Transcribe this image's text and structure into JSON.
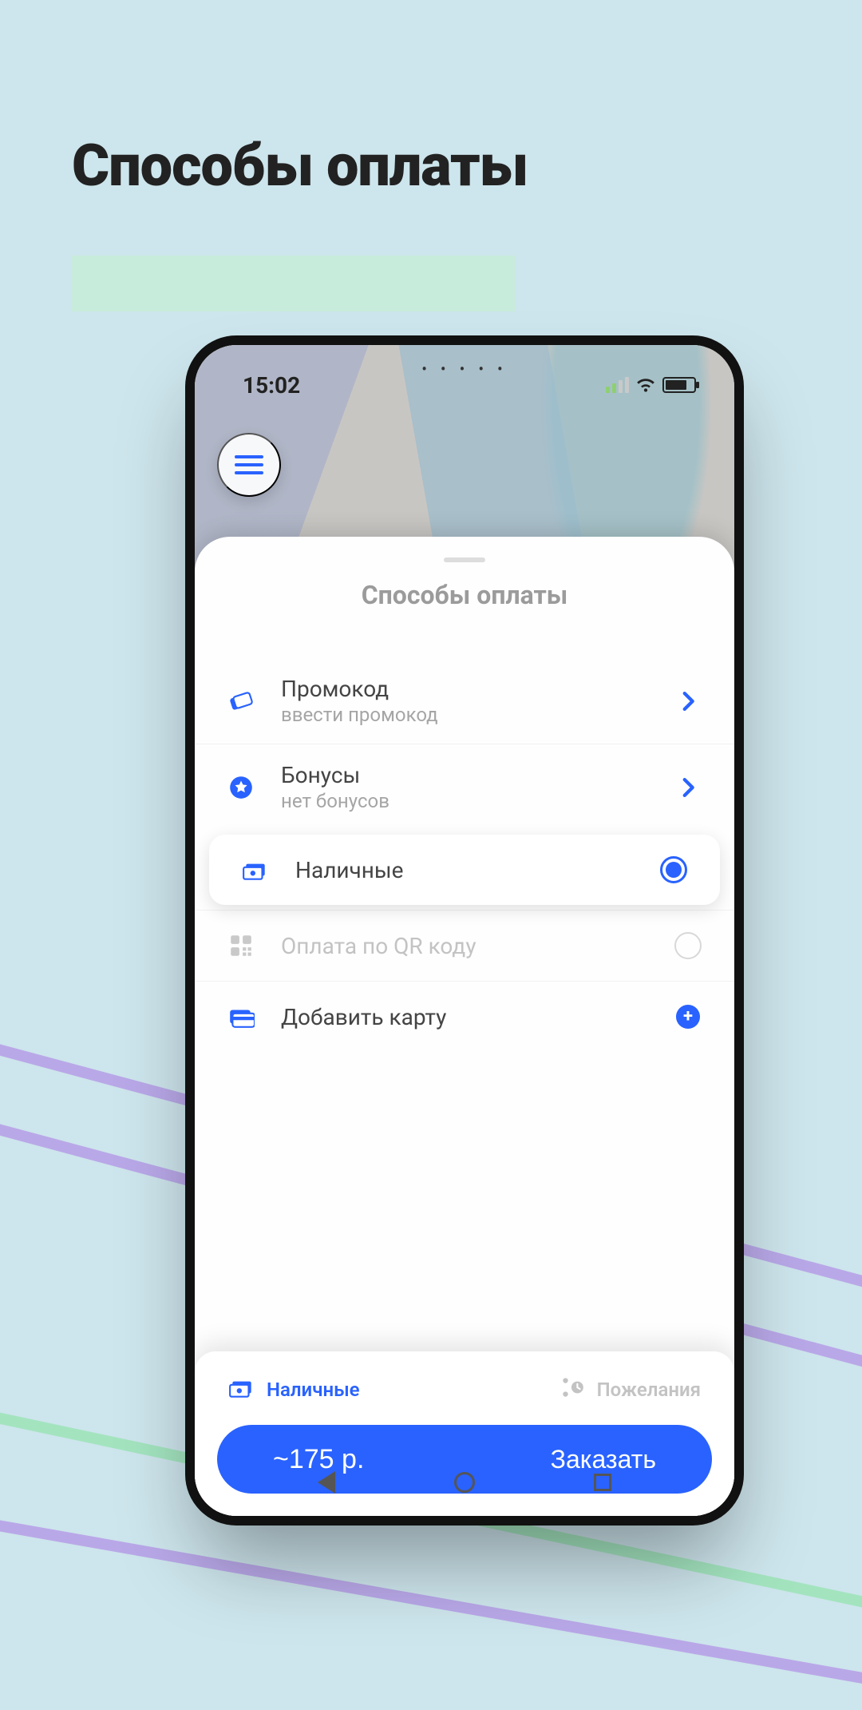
{
  "page": {
    "heading": "Способы оплаты"
  },
  "status": {
    "time": "15:02"
  },
  "sheet": {
    "title": "Способы оплаты",
    "promocode": {
      "title": "Промокод",
      "subtitle": "ввести промокод"
    },
    "bonuses": {
      "title": "Бонусы",
      "subtitle": "нет бонусов"
    },
    "cash": {
      "title": "Наличные"
    },
    "qr": {
      "title": "Оплата по QR коду"
    },
    "addCard": {
      "title": "Добавить карту"
    }
  },
  "footer": {
    "cash_label": "Наличные",
    "wishes_label": "Пожелания",
    "price": "~175 р.",
    "order": "Заказать"
  },
  "colors": {
    "accent": "#2962ff"
  }
}
